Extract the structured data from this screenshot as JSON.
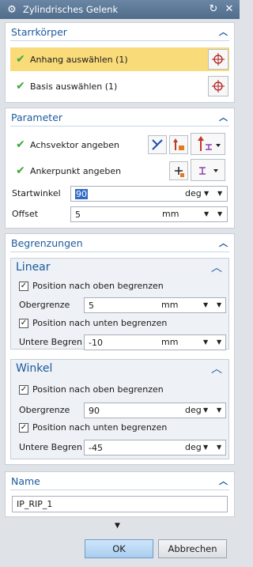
{
  "title": "Zylindrisches Gelenk",
  "starrkoerper": {
    "heading": "Starrkörper",
    "rows": [
      {
        "label": "Anhang auswählen (1)"
      },
      {
        "label": "Basis auswählen (1)"
      }
    ]
  },
  "parameter": {
    "heading": "Parameter",
    "achsvektor_label": "Achsvektor angeben",
    "ankerpunkt_label": "Ankerpunkt angeben",
    "startwinkel": {
      "label": "Startwinkel",
      "value": "90",
      "unit": "deg"
    },
    "offset": {
      "label": "Offset",
      "value": "5",
      "unit": "mm"
    }
  },
  "begrenzungen": {
    "heading": "Begrenzungen",
    "linear": {
      "heading": "Linear",
      "upper_check": "Position nach oben begrenzen",
      "upper": {
        "label": "Obergrenze",
        "value": "5",
        "unit": "mm"
      },
      "lower_check": "Position nach unten begrenzen",
      "lower": {
        "label": "Untere Begren",
        "value": "-10",
        "unit": "mm"
      }
    },
    "winkel": {
      "heading": "Winkel",
      "upper_check": "Position nach oben begrenzen",
      "upper": {
        "label": "Obergrenze",
        "value": "90",
        "unit": "deg"
      },
      "lower_check": "Position nach unten begrenzen",
      "lower": {
        "label": "Untere Begren",
        "value": "-45",
        "unit": "deg"
      }
    }
  },
  "name_section": {
    "heading": "Name",
    "value": "IP_RIP_1"
  },
  "buttons": {
    "ok": "OK",
    "cancel": "Abbrechen"
  },
  "glyphs": {
    "check": "✔",
    "collapse": "⌃",
    "dropdown": "▼",
    "checkbox": "✓"
  },
  "colors": {
    "accent": "#1b5a9c",
    "selected_row": "#fadb7a",
    "check_green": "#3aa63a"
  }
}
